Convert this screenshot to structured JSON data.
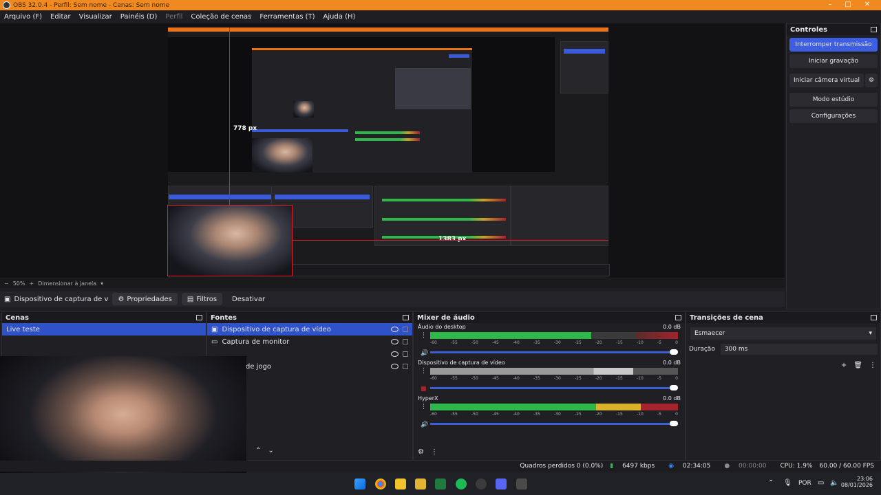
{
  "window": {
    "title": "OBS 32.0.4 - Perfil: Sem nome - Cenas: Sem nome"
  },
  "menu": [
    "Arquivo (F)",
    "Editar",
    "Visualizar",
    "Painéis (D)",
    "Perfil",
    "Coleção de cenas",
    "Ferramentas (T)",
    "Ajuda (H)"
  ],
  "preview": {
    "label_h": "778 px",
    "label_w": "1383 px"
  },
  "zoom": {
    "value": "50%",
    "mode": "Dimensionar à janela"
  },
  "source_toolbar": {
    "source": "Dispositivo de captura de v",
    "properties": "Propriedades",
    "filters": "Filtros",
    "deactivate": "Desativar"
  },
  "controls": {
    "title": "Controles",
    "buttons": [
      "Interromper transmissão",
      "Iniciar gravação",
      "Iniciar câmera virtual",
      "Modo estúdio",
      "Configurações"
    ]
  },
  "scenes": {
    "title": "Cenas",
    "items": [
      "Live teste"
    ]
  },
  "sources": {
    "title": "Fontes",
    "items": [
      "Dispositivo de captura de vídeo",
      "Captura de monitor",
      "",
      "de jogo"
    ]
  },
  "mixer": {
    "title": "Mixer de áudio",
    "channels": [
      {
        "name": "Áudio do desktop",
        "db": "0.0 dB"
      },
      {
        "name": "Dispositivo de captura de vídeo",
        "db": "0.0 dB"
      },
      {
        "name": "HyperX",
        "db": "0.0 dB"
      }
    ],
    "scale": [
      "-60",
      "-55",
      "-50",
      "-45",
      "-40",
      "-35",
      "-30",
      "-25",
      "-20",
      "-15",
      "-10",
      "-5",
      "0"
    ]
  },
  "transitions": {
    "title": "Transições de cena",
    "selected": "Esmaecer",
    "duration_label": "Duração",
    "duration": "300 ms"
  },
  "status": {
    "dropped": "Quadros perdidos 0 (0.0%)",
    "kbps": "6497 kbps",
    "live_time": "02:34:05",
    "rec_time": "00:00:00",
    "cpu": "CPU: 1.9%",
    "fps": "60.00 / 60.00 FPS"
  },
  "taskbar": {
    "lang": "POR",
    "time": "23:06",
    "date": "08/01/2026"
  }
}
